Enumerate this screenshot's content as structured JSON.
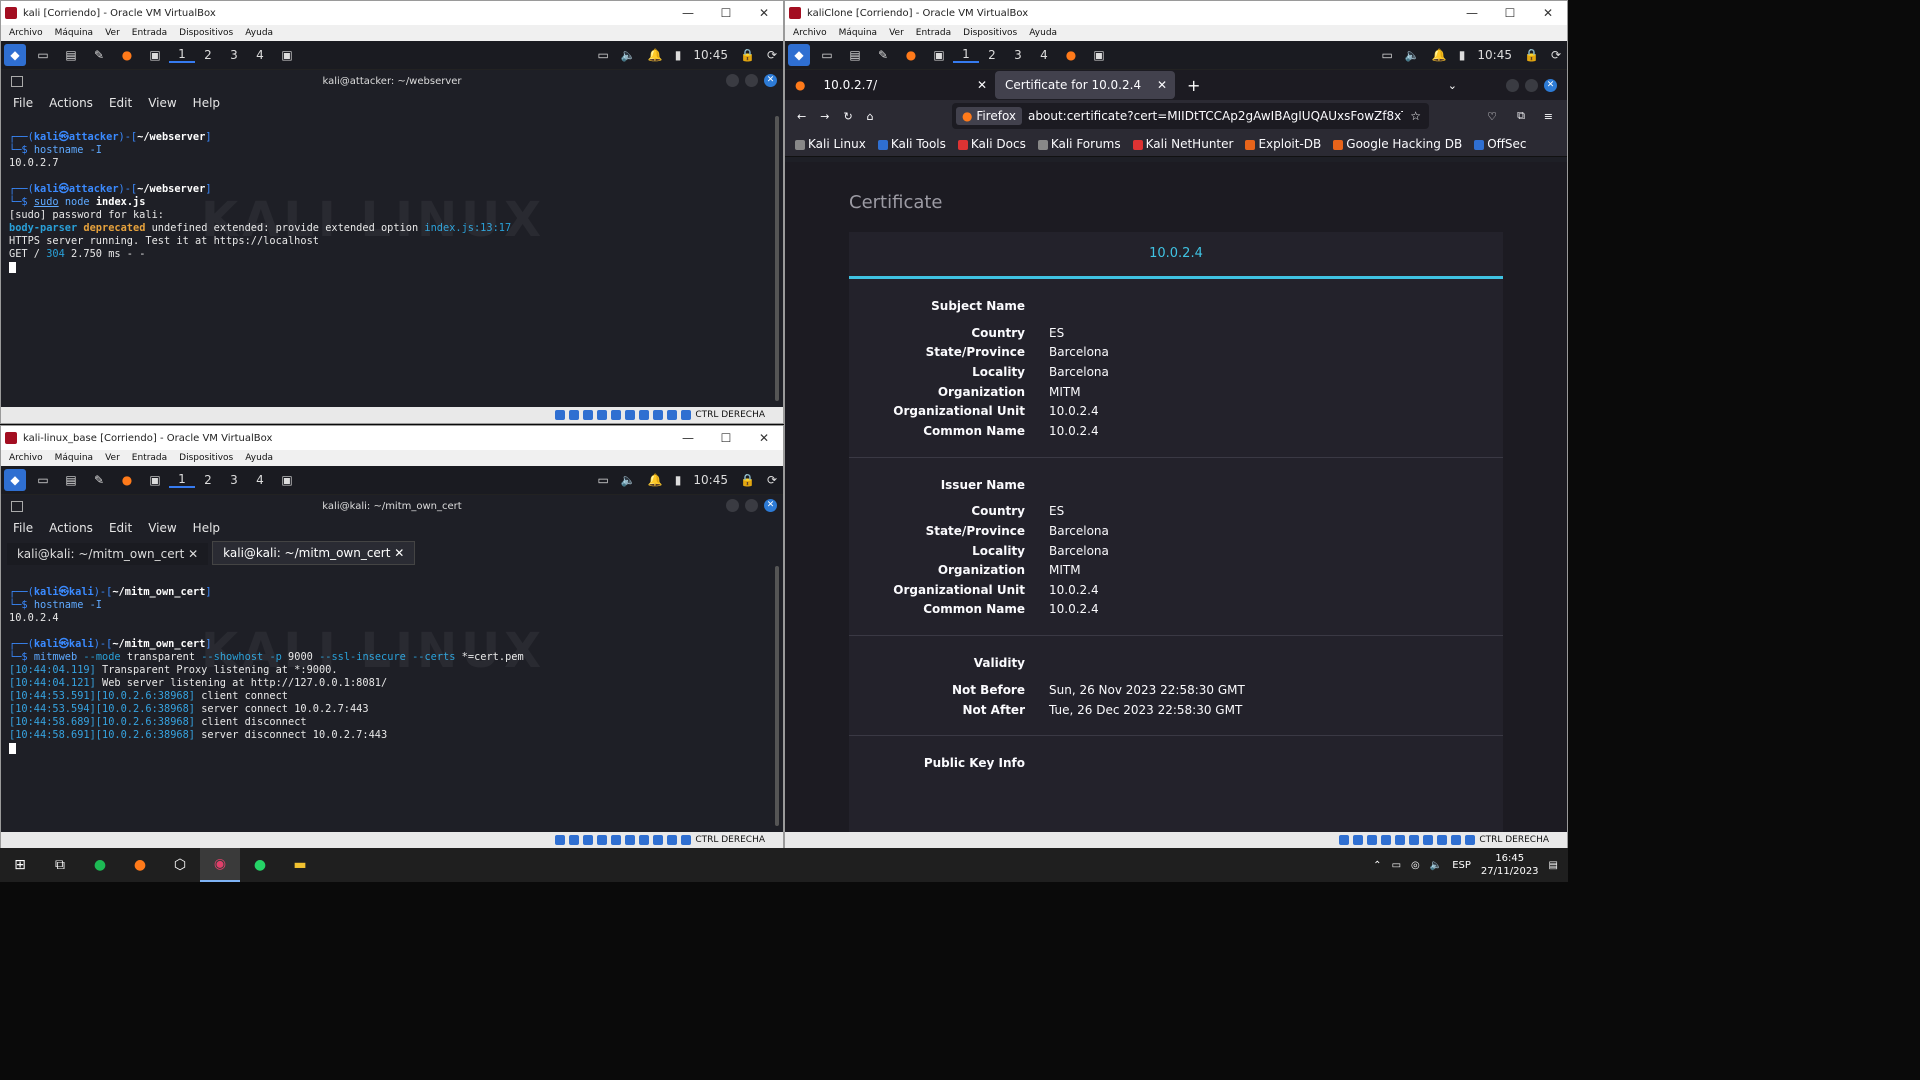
{
  "win1": {
    "title": "kali [Corriendo] - Oracle VM VirtualBox",
    "menu": [
      "Archivo",
      "Máquina",
      "Ver",
      "Entrada",
      "Dispositivos",
      "Ayuda"
    ],
    "panel": {
      "workspaces": [
        "1",
        "2",
        "3",
        "4"
      ],
      "clock": "10:45"
    },
    "terminal_title": "kali@attacker: ~/webserver",
    "term_menu": [
      "File",
      "Actions",
      "Edit",
      "View",
      "Help"
    ],
    "lines": {
      "l1_user": "kali",
      "l1_at": "㉿",
      "l1_host": "attacker",
      "l1_dir": "~/webserver",
      "l2_cmd": "hostname -I",
      "l3": "10.0.2.7",
      "l5_user": "kali",
      "l5_host": "attacker",
      "l5_dir": "~/webserver",
      "l6_sudo": "sudo",
      "l6_node": "node",
      "l6_file": "index.js",
      "l7": "[sudo] password for kali:",
      "l8_a": "body-parser",
      "l8_b": "deprecated",
      "l8_c": "undefined extended: provide extended option",
      "l8_d": "index.js:13:17",
      "l9": "HTTPS server running. Test it at https://localhost",
      "l10_a": "GET / ",
      "l10_b": "304",
      "l10_c": " 2.750 ms - -"
    },
    "status_right": "CTRL DERECHA"
  },
  "win2": {
    "title": "kali-linux_base [Corriendo] - Oracle VM VirtualBox",
    "menu": [
      "Archivo",
      "Máquina",
      "Ver",
      "Entrada",
      "Dispositivos",
      "Ayuda"
    ],
    "panel": {
      "workspaces": [
        "1",
        "2",
        "3",
        "4"
      ],
      "clock": "10:45"
    },
    "terminal_title": "kali@kali: ~/mitm_own_cert",
    "term_menu": [
      "File",
      "Actions",
      "Edit",
      "View",
      "Help"
    ],
    "tabs": [
      "kali@kali: ~/mitm_own_cert",
      "kali@kali: ~/mitm_own_cert"
    ],
    "lines": {
      "l1_user": "kali",
      "l1_host": "kali",
      "l1_dir": "~/mitm_own_cert",
      "l2_cmd": "hostname -I",
      "l3": "10.0.2.4",
      "l5_user": "kali",
      "l5_host": "kali",
      "l5_dir": "~/mitm_own_cert",
      "l6_cmd": "mitmweb",
      "l6_a": "--mode",
      "l6_b": "transparent",
      "l6_c": "--showhost",
      "l6_d": "-p",
      "l6_e": "9000",
      "l6_f": "--ssl-insecure",
      "l6_g": "--certs",
      "l6_h": "*=cert.pem",
      "log": [
        {
          "ts": "[10:44:04.119]",
          "src": "",
          "msg": " Transparent Proxy listening at *:9000."
        },
        {
          "ts": "[10:44:04.121]",
          "src": "",
          "msg": " Web server listening at http://127.0.0.1:8081/"
        },
        {
          "ts": "[10:44:53.591]",
          "src": "[10.0.2.6:38968]",
          "msg": " client connect"
        },
        {
          "ts": "[10:44:53.594]",
          "src": "[10.0.2.6:38968]",
          "msg": " server connect 10.0.2.7:443"
        },
        {
          "ts": "[10:44:58.689]",
          "src": "[10.0.2.6:38968]",
          "msg": " client disconnect"
        },
        {
          "ts": "[10:44:58.691]",
          "src": "[10.0.2.6:38968]",
          "msg": " server disconnect 10.0.2.7:443"
        }
      ]
    },
    "status_right": "CTRL DERECHA"
  },
  "win3": {
    "title": "kaliClone [Corriendo] - Oracle VM VirtualBox",
    "menu": [
      "Archivo",
      "Máquina",
      "Ver",
      "Entrada",
      "Dispositivos",
      "Ayuda"
    ],
    "panel": {
      "workspaces": [
        "1",
        "2",
        "3",
        "4"
      ],
      "clock": "10:45"
    },
    "tabs": [
      {
        "label": "10.0.2.7/"
      },
      {
        "label": "Certificate for 10.0.2.4"
      }
    ],
    "url_chip": "Firefox",
    "url": "about:certificate?cert=MIIDtTCCAp2gAwIBAgIUQAUxsFowZf8xTrkg",
    "bookmarks": [
      "Kali Linux",
      "Kali Tools",
      "Kali Docs",
      "Kali Forums",
      "Kali NetHunter",
      "Exploit-DB",
      "Google Hacking DB",
      "OffSec"
    ],
    "page_heading": "Certificate",
    "cert_tab": "10.0.2.4",
    "subject": {
      "heading": "Subject Name",
      "rows": [
        [
          "Country",
          "ES"
        ],
        [
          "State/Province",
          "Barcelona"
        ],
        [
          "Locality",
          "Barcelona"
        ],
        [
          "Organization",
          "MITM"
        ],
        [
          "Organizational Unit",
          "10.0.2.4"
        ],
        [
          "Common Name",
          "10.0.2.4"
        ]
      ]
    },
    "issuer": {
      "heading": "Issuer Name",
      "rows": [
        [
          "Country",
          "ES"
        ],
        [
          "State/Province",
          "Barcelona"
        ],
        [
          "Locality",
          "Barcelona"
        ],
        [
          "Organization",
          "MITM"
        ],
        [
          "Organizational Unit",
          "10.0.2.4"
        ],
        [
          "Common Name",
          "10.0.2.4"
        ]
      ]
    },
    "validity": {
      "heading": "Validity",
      "rows": [
        [
          "Not Before",
          "Sun, 26 Nov 2023 22:58:30 GMT"
        ],
        [
          "Not After",
          "Tue, 26 Dec 2023 22:58:30 GMT"
        ]
      ]
    },
    "pubkey_heading": "Public Key Info",
    "status_right": "CTRL DERECHA"
  },
  "taskbar": {
    "lang": "ESP",
    "time": "16:45",
    "date": "27/11/2023"
  },
  "colors": {
    "kali_blue": "#367bf0",
    "firefox_accent": "#3fc3e3",
    "virtualbox_red": "#a30e21"
  }
}
